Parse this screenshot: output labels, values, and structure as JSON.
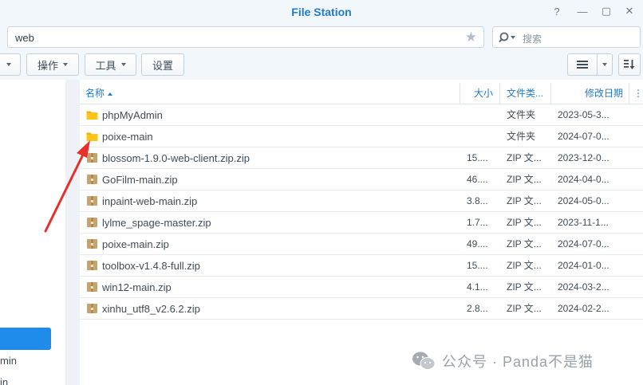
{
  "window": {
    "title": "File Station",
    "controls": {
      "help": "?",
      "minimize": "—",
      "maximize": "▢",
      "close": "✕"
    }
  },
  "pathbar": {
    "path": "web",
    "search_placeholder": "搜索"
  },
  "toolbar": {
    "action_label": "操作",
    "tools_label": "工具",
    "settings_label": "设置"
  },
  "sidebar": {
    "partial_label": "min",
    "partial_label2": "in"
  },
  "columns": {
    "name": "名称",
    "size": "大小",
    "type": "文件类...",
    "modified": "修改日期",
    "more": "⋮"
  },
  "files": [
    {
      "name": "phpMyAdmin",
      "size": "",
      "type": "文件夹",
      "modified": "2023-05-3...",
      "icon": "folder-icon"
    },
    {
      "name": "poixe-main",
      "size": "",
      "type": "文件夹",
      "modified": "2024-07-0...",
      "icon": "folder-icon"
    },
    {
      "name": "blossom-1.9.0-web-client.zip.zip",
      "size": "15....",
      "type": "ZIP 文...",
      "modified": "2023-12-0...",
      "icon": "zip-icon"
    },
    {
      "name": "GoFilm-main.zip",
      "size": "46....",
      "type": "ZIP 文...",
      "modified": "2024-04-0...",
      "icon": "zip-icon"
    },
    {
      "name": "inpaint-web-main.zip",
      "size": "3.8...",
      "type": "ZIP 文...",
      "modified": "2024-05-0...",
      "icon": "zip-icon"
    },
    {
      "name": "lylme_spage-master.zip",
      "size": "1.7...",
      "type": "ZIP 文...",
      "modified": "2023-11-1...",
      "icon": "zip-icon"
    },
    {
      "name": "poixe-main.zip",
      "size": "49....",
      "type": "ZIP 文...",
      "modified": "2024-07-0...",
      "icon": "zip-icon"
    },
    {
      "name": "toolbox-v1.4.8-full.zip",
      "size": "15....",
      "type": "ZIP 文...",
      "modified": "2024-01-0...",
      "icon": "zip-icon"
    },
    {
      "name": "win12-main.zip",
      "size": "4.1...",
      "type": "ZIP 文...",
      "modified": "2024-03-2...",
      "icon": "zip-icon"
    },
    {
      "name": "xinhu_utf8_v2.6.2.zip",
      "size": "2.8...",
      "type": "ZIP 文...",
      "modified": "2024-02-2...",
      "icon": "zip-icon"
    }
  ],
  "colors": {
    "accent": "#1f7acc",
    "selected": "#1f8ceb",
    "folder": "#f7b500",
    "zip": "#c9a46a",
    "arrow": "#e8302a"
  },
  "watermark": {
    "text": "公众号 · Panda不是猫"
  }
}
